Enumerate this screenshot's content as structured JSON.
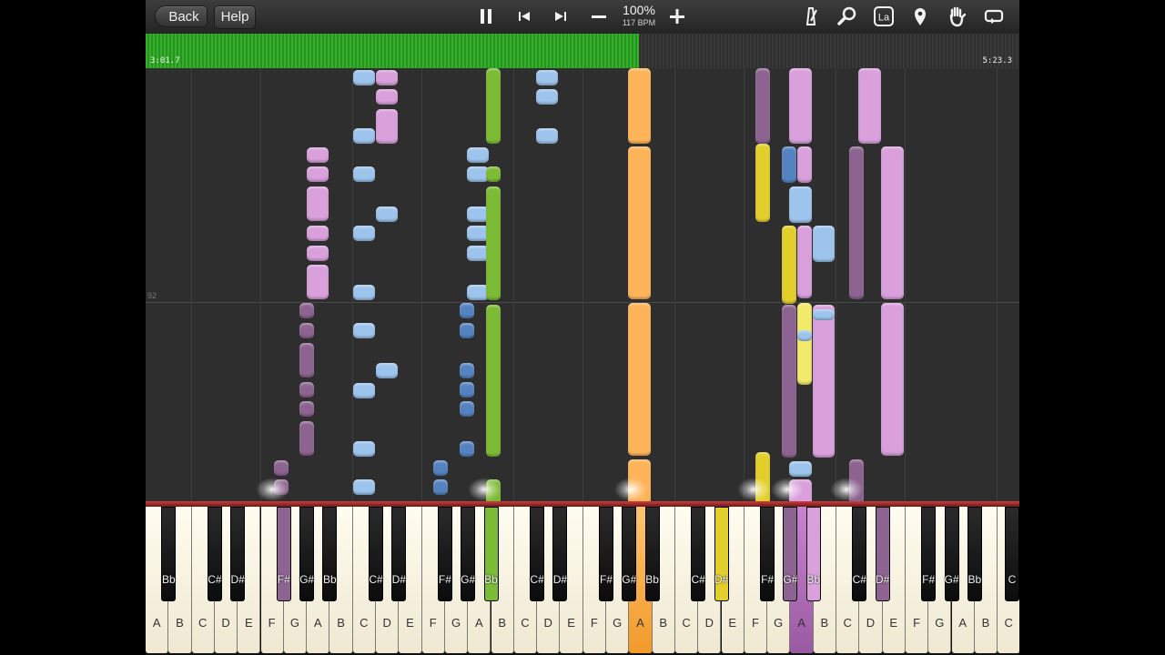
{
  "toolbar": {
    "back_label": "Back",
    "help_label": "Help",
    "zoom_percent": "100%",
    "tempo": "117 BPM",
    "icons": [
      "pause-icon",
      "skip-back-icon",
      "skip-forward-icon",
      "minus-icon",
      "plus-icon",
      "metronome-icon",
      "magnifier-icon",
      "note-label-icon",
      "location-pin-icon",
      "hand-icon",
      "loop-icon"
    ]
  },
  "progress": {
    "current_time": "3:01.7",
    "total_time": "5:23.3",
    "fraction": 0.565
  },
  "roll": {
    "measure_number": "92"
  },
  "keyboard": {
    "white_keys": [
      "A",
      "B",
      "C",
      "D",
      "E",
      "F",
      "G",
      "A",
      "B",
      "C",
      "D",
      "E",
      "F",
      "G",
      "A",
      "B",
      "C",
      "D",
      "E",
      "F",
      "G",
      "A",
      "B",
      "C",
      "D",
      "E",
      "F",
      "G",
      "A",
      "B",
      "C",
      "D",
      "E",
      "F",
      "G",
      "A",
      "B",
      "C"
    ],
    "black_keys": [
      "Bb",
      "C#",
      "D#",
      "F#",
      "G#",
      "Bb",
      "C#",
      "D#",
      "F#",
      "G#",
      "Bb",
      "C#",
      "D#",
      "F#",
      "G#",
      "Bb",
      "C#",
      "D#",
      "F#",
      "G#",
      "Bb",
      "C#",
      "D#",
      "F#",
      "G#",
      "Bb",
      "C"
    ],
    "pressed_white": [
      21,
      28
    ],
    "pressed_black": [
      3,
      10,
      17,
      19,
      20,
      22
    ]
  },
  "colors": {
    "progress_green": "#34b02a",
    "light_blue": "#9dc4ec",
    "dark_blue": "#5583c2",
    "pink": "#d9a0dc",
    "purple": "#8d6391",
    "green": "#7cbb34",
    "orange": "#ffb45a",
    "yellow": "#e3cf2c",
    "light_yellow": "#f2ea6a",
    "keyboard_divider": "#c43535"
  }
}
